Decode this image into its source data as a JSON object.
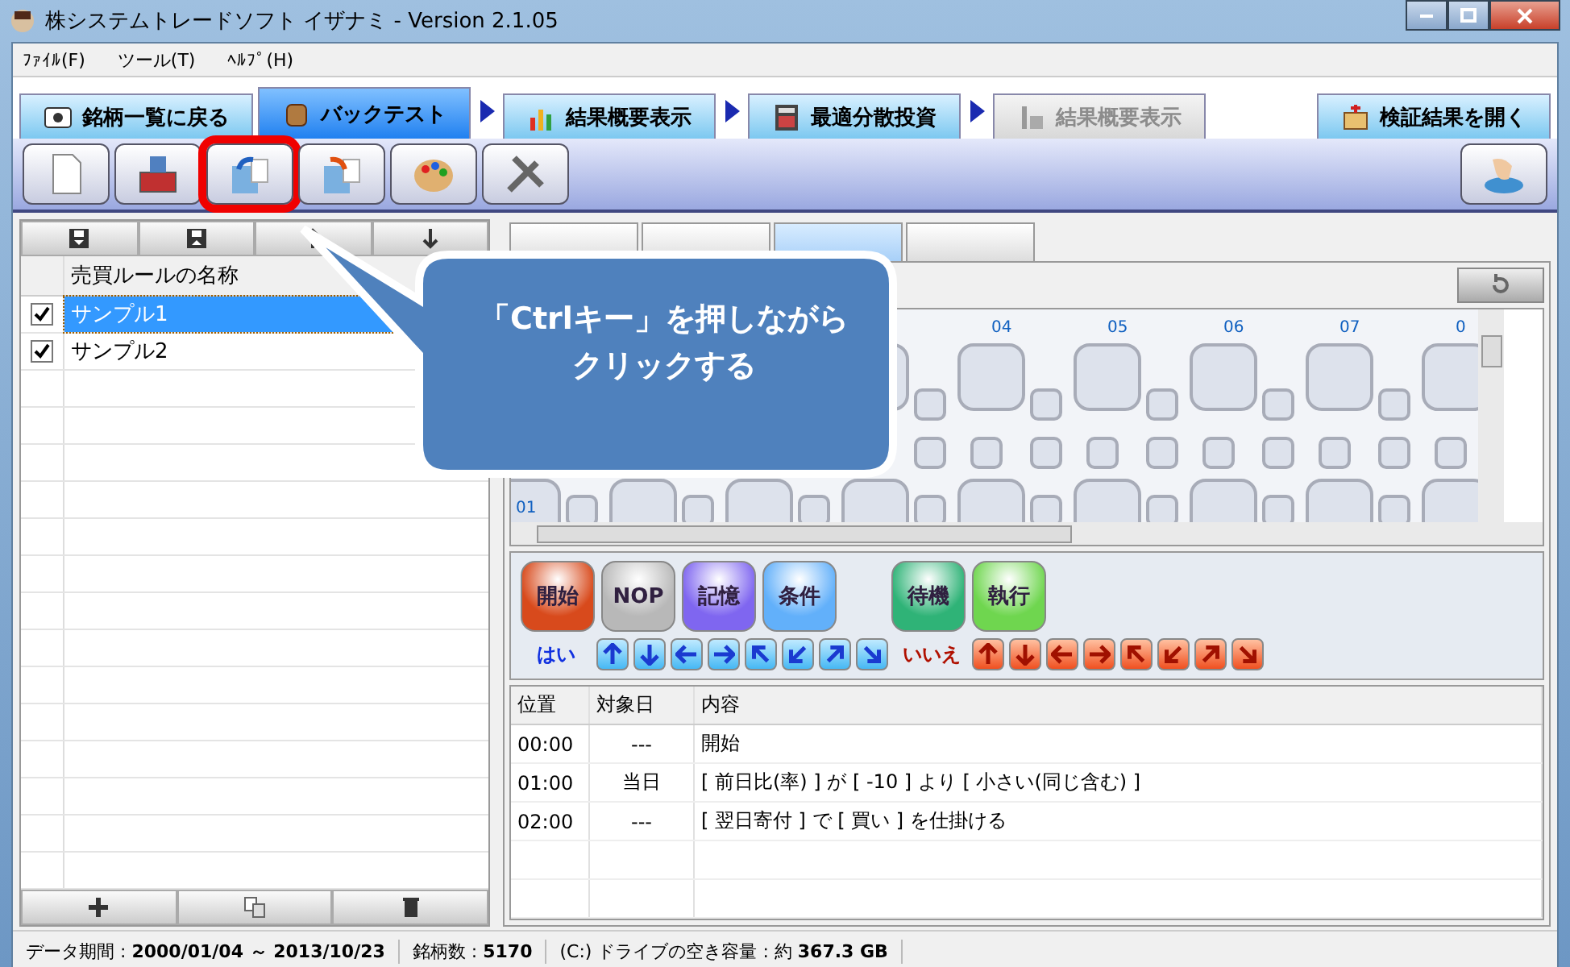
{
  "window": {
    "title": "株システムトレードソフト イザナミ - Version 2.1.05"
  },
  "menu": [
    {
      "label": "ﾌｧｲﾙ(F)"
    },
    {
      "label": "ツール(T)"
    },
    {
      "label": "ﾍﾙﾌﾟ(H)"
    }
  ],
  "main_tabs": [
    {
      "label": "銘柄一覧に戻る",
      "selected": false,
      "disabled": false,
      "arrow": false
    },
    {
      "label": "バックテスト",
      "selected": true,
      "disabled": false,
      "arrow": false
    },
    {
      "label": "結果概要表示",
      "selected": false,
      "disabled": false,
      "arrow": true
    },
    {
      "label": "最適分散投資",
      "selected": false,
      "disabled": false,
      "arrow": true
    },
    {
      "label": "結果概要表示",
      "selected": false,
      "disabled": true,
      "arrow": true
    },
    {
      "label": "検証結果を開く",
      "selected": false,
      "disabled": false,
      "arrow": false
    }
  ],
  "toolbar": [
    {
      "highlighted": false
    },
    {
      "highlighted": false
    },
    {
      "highlighted": true
    },
    {
      "highlighted": false
    },
    {
      "highlighted": false
    },
    {
      "highlighted": false
    }
  ],
  "rule_table": {
    "column": "売買ルールの名称",
    "rows": [
      {
        "name": "サンプル1",
        "checked": true,
        "selected": true
      },
      {
        "name": "サンプル2",
        "checked": true,
        "selected": false
      }
    ]
  },
  "sub_tabs": [
    {
      "selected": false
    },
    {
      "selected": false
    },
    {
      "selected": true
    },
    {
      "selected": false
    }
  ],
  "grid": {
    "columns": [
      "04",
      "05",
      "06",
      "07",
      "0"
    ],
    "rows": [
      "01"
    ]
  },
  "command_groups": [
    [
      {
        "label": "開始",
        "color": "#d84a1c"
      },
      {
        "label": "NOP",
        "color": "#b8b8b8"
      },
      {
        "label": "記憶",
        "color": "#7f66f0"
      },
      {
        "label": "条件",
        "color": "#62b0fa"
      }
    ],
    [
      {
        "label": "待機",
        "color": "#2fb377"
      },
      {
        "label": "執行",
        "color": "#6fd64f"
      }
    ]
  ],
  "yes_label": "はい",
  "no_label": "いいえ",
  "steps_table": {
    "columns": [
      "位置",
      "対象日",
      "内容"
    ],
    "rows": [
      [
        "00:00",
        "---",
        "開始"
      ],
      [
        "01:00",
        "当日",
        "[ 前日比(率) ] が [ -10 ] より [ 小さい(同じ含む) ]"
      ],
      [
        "02:00",
        "---",
        "[ 翌日寄付 ] で [ 買い ] を仕掛ける"
      ]
    ]
  },
  "status_bar": [
    "データ期間 : **2000/01/04 ～ 2013/10/23**",
    "銘柄数 : **5170**",
    "(C:) ドライブの空き容量 : 約 **367.3 GB**"
  ],
  "callout": {
    "lines": [
      "「Ctrlキー」を押しながら",
      "クリックする"
    ]
  }
}
